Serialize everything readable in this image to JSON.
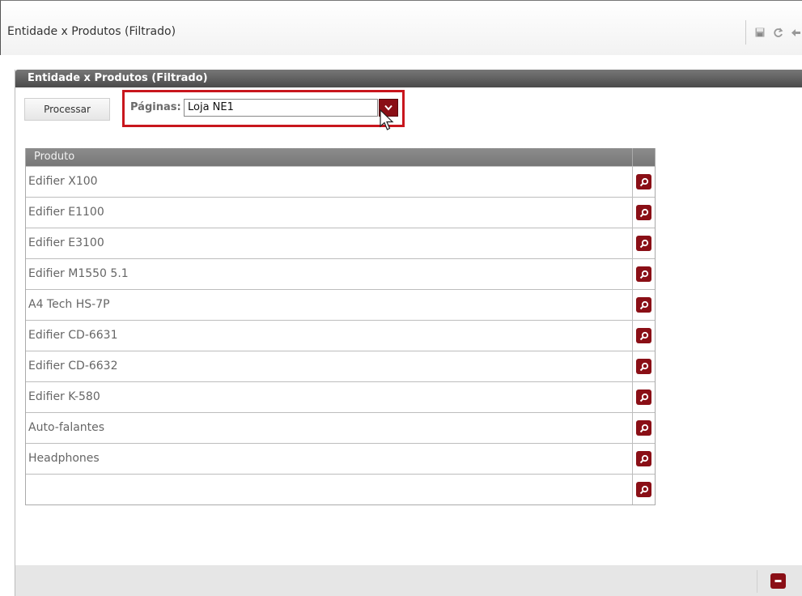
{
  "window": {
    "title": "Entidade x Produtos (Filtrado)",
    "tools": [
      "save-icon",
      "refresh-icon",
      "back-icon"
    ]
  },
  "panel": {
    "title": "Entidade x Produtos (Filtrado)"
  },
  "toolbar": {
    "processar_label": "Processar",
    "paginas_label": "Páginas:",
    "paginas_value": "Loja NE1"
  },
  "grid": {
    "column_header": "Produto",
    "rows": [
      "Edifier X100",
      "Edifier E1100",
      "Edifier E3100",
      "Edifier M1550 5.1",
      "A4 Tech HS-7P",
      "Edifier CD-6631",
      "Edifier CD-6632",
      "Edifier K-580",
      "Auto-falantes",
      "Headphones",
      ""
    ]
  },
  "colors": {
    "accent": "#8a0f16",
    "highlight": "#c8161d",
    "header": "#555555"
  }
}
